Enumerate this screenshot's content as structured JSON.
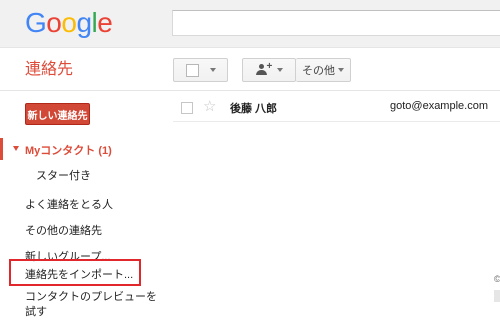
{
  "header": {
    "logo_letters": [
      {
        "char": "G",
        "color": "#4285f4"
      },
      {
        "char": "o",
        "color": "#ea4335"
      },
      {
        "char": "o",
        "color": "#fbbc05"
      },
      {
        "char": "g",
        "color": "#4285f4"
      },
      {
        "char": "l",
        "color": "#34a853"
      },
      {
        "char": "e",
        "color": "#ea4335"
      }
    ],
    "search_value": ""
  },
  "app": {
    "title": "連絡先"
  },
  "toolbar": {
    "add_icon_plus": "+",
    "more_label": "その他"
  },
  "sidebar": {
    "new_contact_label": "新しい連絡先",
    "my_contacts_label": "Myコンタクト (1)",
    "starred_label": "スター付き",
    "frequent_label": "よく連絡をとる人",
    "other_label": "その他の連絡先",
    "new_group_label": "新しいグループ...",
    "import_label": "連絡先をインポート...",
    "preview_label": "コンタクトのプレビューを試す"
  },
  "contacts": [
    {
      "star": "☆",
      "name": "後藤 八郎",
      "email": "goto@example.com"
    }
  ],
  "edge": {
    "char": "©"
  },
  "colors": {
    "accent": "#dd4b39",
    "new_button": "#d14836",
    "highlight": "#e1262c"
  }
}
